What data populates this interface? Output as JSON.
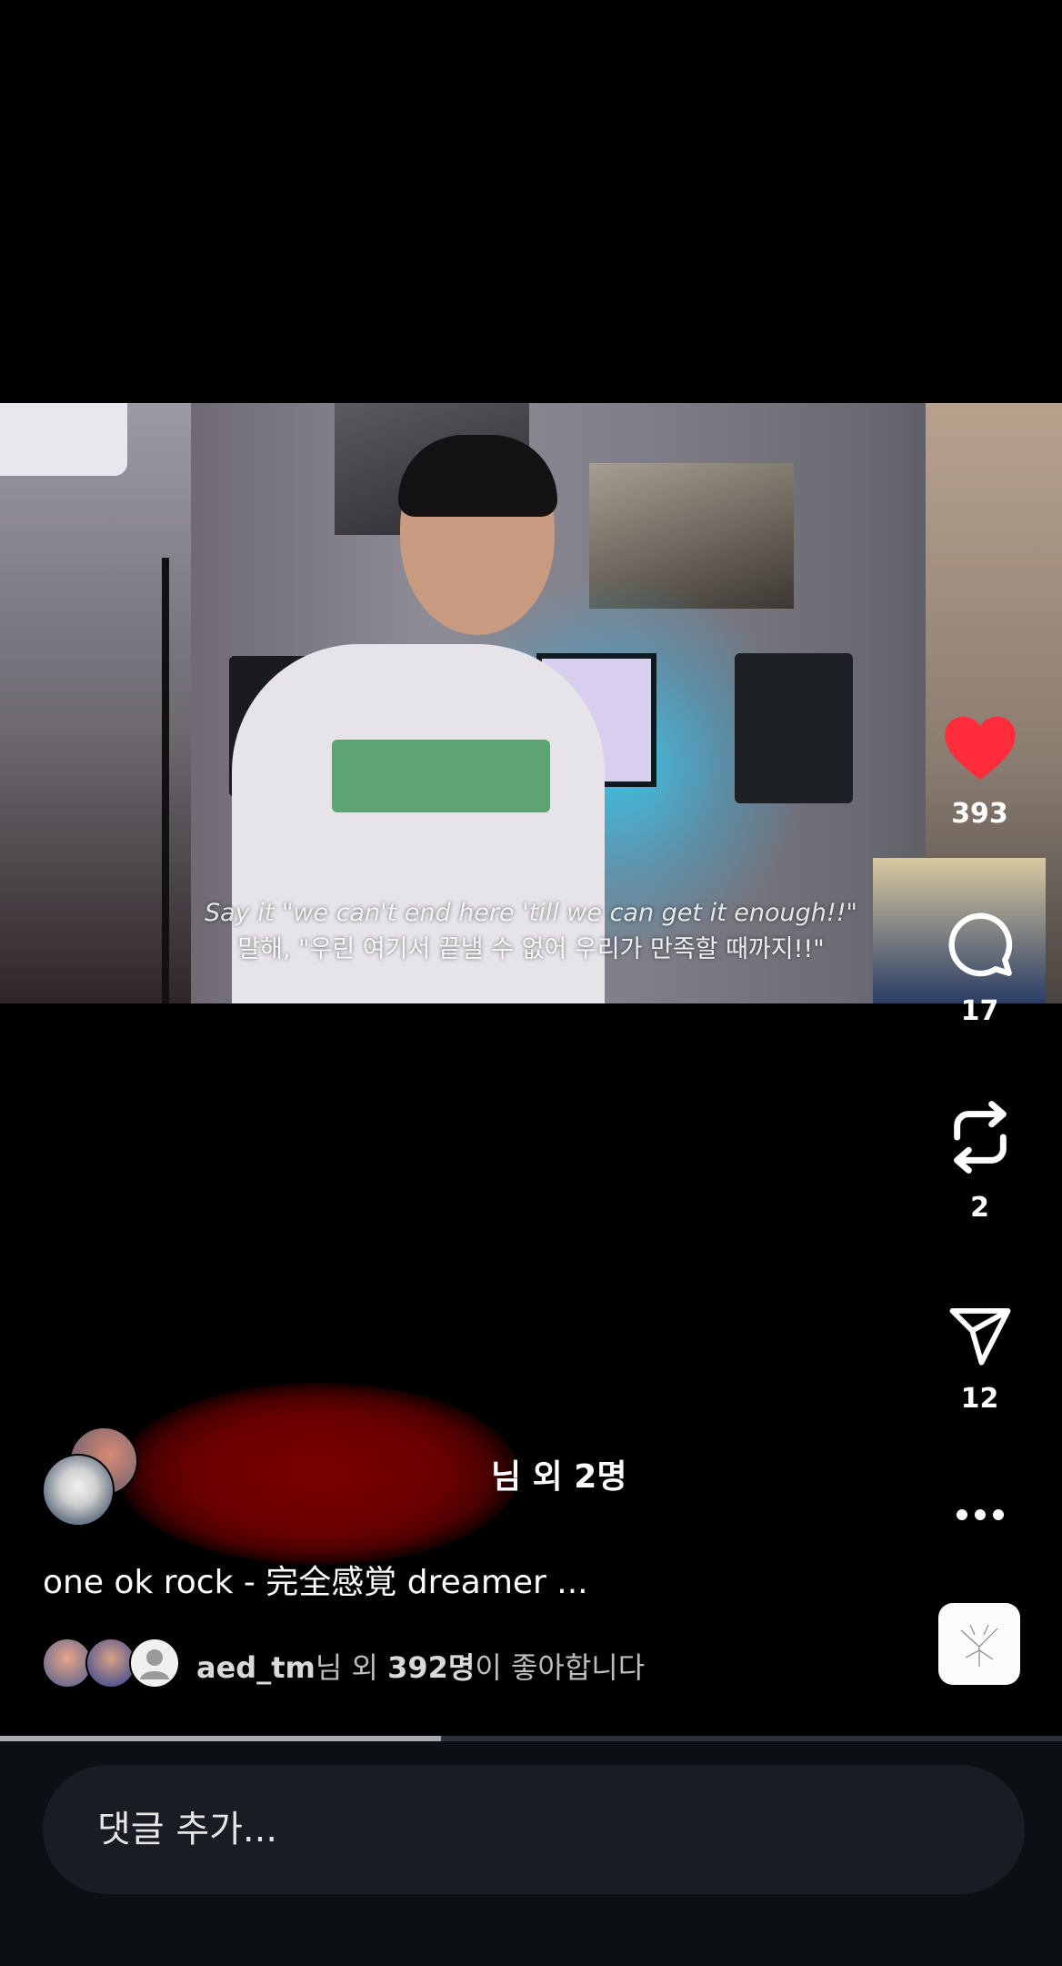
{
  "video": {
    "subtitle_en": "Say it \"we can't end here 'till we can get it enough!!\"",
    "subtitle_ko": "말해, \"우린 여기서 끝낼 수 없어 우리가 만족할 때까지!!\""
  },
  "actions": {
    "like": {
      "count": "393",
      "icon": "heart-icon",
      "color": "#ff2d3b"
    },
    "comment": {
      "count": "17",
      "icon": "comment-bubble-icon"
    },
    "repost": {
      "count": "2",
      "icon": "repost-icon"
    },
    "share": {
      "count": "12",
      "icon": "send-paper-plane-icon"
    },
    "more": {
      "icon": "more-dots-icon"
    }
  },
  "post": {
    "likers_suffix": "님 외 2명",
    "caption": "one ok rock - 完全感覚 dreamer ...",
    "likes_user": "aed_tm",
    "likes_mid": "님 외 ",
    "likes_count": "392명",
    "likes_tail": "이 좋아합니다"
  },
  "progress": {
    "fraction": 0.415
  },
  "composer": {
    "placeholder": "댓글 추가..."
  }
}
